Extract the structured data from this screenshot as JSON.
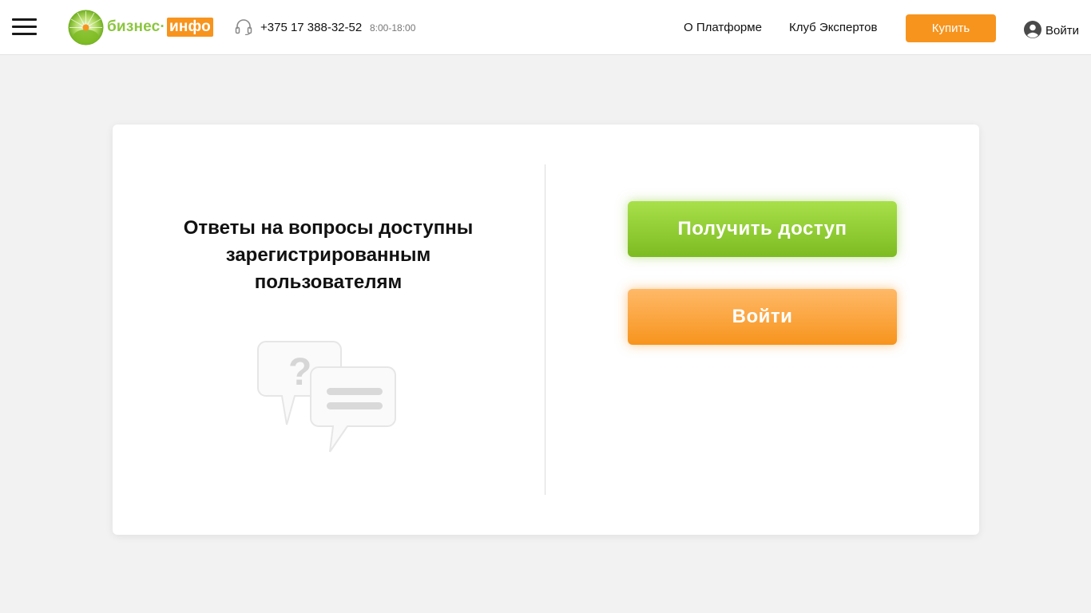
{
  "header": {
    "logo": {
      "word1": "бизнес",
      "separator": "·",
      "word2": "инфо"
    },
    "phone": "+375 17 388-32-52",
    "hours": "8:00-18:00",
    "nav": {
      "about": "О Платформе",
      "club": "Клуб Экспертов"
    },
    "buy_label": "Купить",
    "login_label": "Войти"
  },
  "main": {
    "title_line1": "Ответы на вопросы доступны",
    "title_line2": "зарегистрированным",
    "title_line3": "пользователям",
    "access_button": "Получить доступ",
    "login_button": "Войти"
  },
  "colors": {
    "accent_orange": "#f7941d",
    "accent_green": "#8cc63f",
    "background": "#f2f2f2"
  },
  "icons": [
    "menu-icon",
    "logo-sun-icon",
    "headset-icon",
    "user-circle-icon",
    "question-chat-icon"
  ]
}
